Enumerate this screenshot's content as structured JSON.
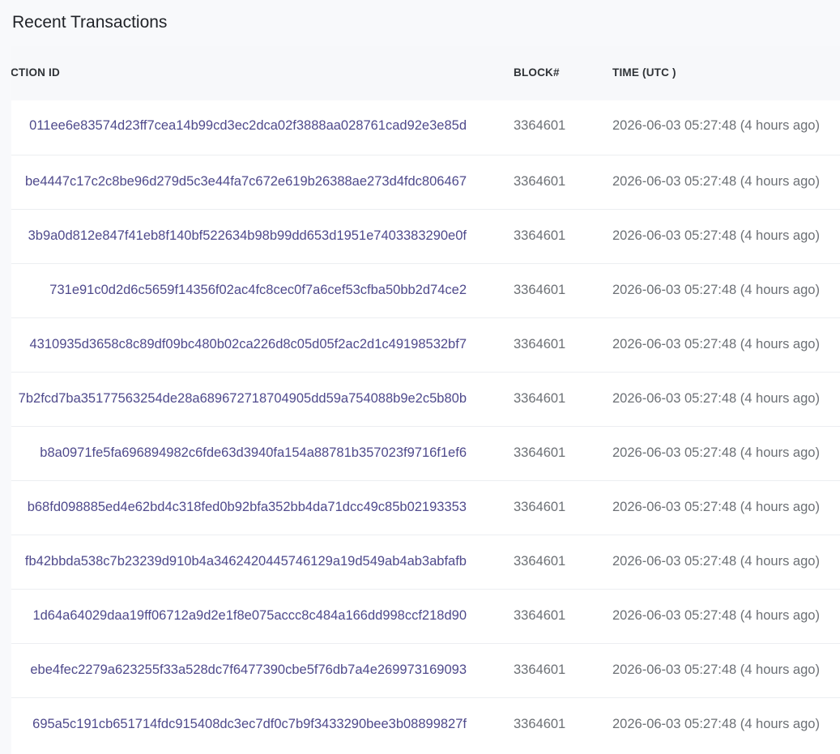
{
  "title": "Recent Transactions",
  "table": {
    "headers": {
      "txid": "NSACTION ID",
      "block": "BLOCK#",
      "time": "TIME (UTC )"
    },
    "rows": [
      {
        "txid": "011ee6e83574d23ff7cea14b99cd3ec2dca02f3888aa028761cad92e3e85d",
        "block": "3364601",
        "time": "2026-06-03 05:27:48 (4 hours ago)"
      },
      {
        "txid": "be4447c17c2c8be96d279d5c3e44fa7c672e619b26388ae273d4fdc806467",
        "block": "3364601",
        "time": "2026-06-03 05:27:48 (4 hours ago)"
      },
      {
        "txid": "3b9a0d812e847f41eb8f140bf522634b98b99dd653d1951e7403383290e0f",
        "block": "3364601",
        "time": "2026-06-03 05:27:48 (4 hours ago)"
      },
      {
        "txid": "731e91c0d2d6c5659f14356f02ac4fc8cec0f7a6cef53cfba50bb2d74ce2",
        "block": "3364601",
        "time": "2026-06-03 05:27:48 (4 hours ago)"
      },
      {
        "txid": "4310935d3658c8c89df09bc480b02ca226d8c05d05f2ac2d1c49198532bf7",
        "block": "3364601",
        "time": "2026-06-03 05:27:48 (4 hours ago)"
      },
      {
        "txid": "7b2fcd7ba35177563254de28a689672718704905dd59a754088b9e2c5b80b",
        "block": "3364601",
        "time": "2026-06-03 05:27:48 (4 hours ago)"
      },
      {
        "txid": "b8a0971fe5fa696894982c6fde63d3940fa154a88781b357023f9716f1ef6",
        "block": "3364601",
        "time": "2026-06-03 05:27:48 (4 hours ago)"
      },
      {
        "txid": "b68fd098885ed4e62bd4c318fed0b92bfa352bb4da71dcc49c85b02193353",
        "block": "3364601",
        "time": "2026-06-03 05:27:48 (4 hours ago)"
      },
      {
        "txid": "fb42bbda538c7b23239d910b4a3462420445746129a19d549ab4ab3abfafb",
        "block": "3364601",
        "time": "2026-06-03 05:27:48 (4 hours ago)"
      },
      {
        "txid": "1d64a64029daa19ff06712a9d2e1f8e075accc8c484a166dd998ccf218d90",
        "block": "3364601",
        "time": "2026-06-03 05:27:48 (4 hours ago)"
      },
      {
        "txid": "ebe4fec2279a623255f33a528dc7f6477390cbe5f76db7a4e269973169093",
        "block": "3364601",
        "time": "2026-06-03 05:27:48 (4 hours ago)"
      },
      {
        "txid": "695a5c191cb651714fdc915408dc3ec7df0c7b9f3433290bee3b08899827f",
        "block": "3364601",
        "time": "2026-06-03 05:27:48 (4 hours ago)"
      }
    ]
  },
  "colors": {
    "link": "#4f4a8c",
    "muted_text": "#6c7075",
    "header_text": "#2f3337",
    "background": "#f8f9fb"
  }
}
